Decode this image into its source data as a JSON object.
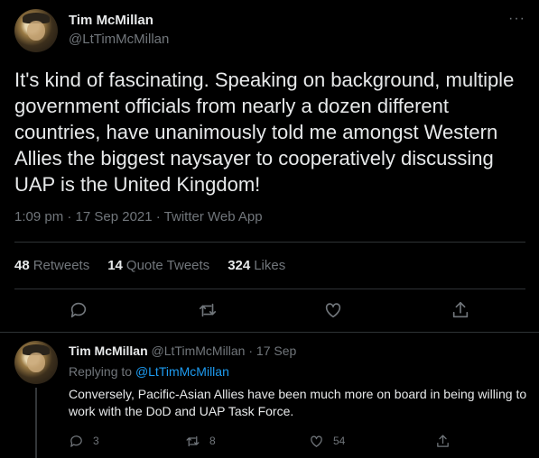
{
  "tweet": {
    "author_name": "Tim McMillan",
    "author_handle": "@LtTimMcMillan",
    "more_glyph": "···",
    "text": "It's kind of fascinating. Speaking on background, multiple government officials from nearly a dozen different countries, have unanimously told me amongst Western Allies the biggest naysayer to cooperatively discussing UAP is the United Kingdom!",
    "timestamp": "1:09 pm · 17 Sep 2021 · Twitter Web App",
    "stats": [
      {
        "count": "48",
        "label": "Retweets"
      },
      {
        "count": "14",
        "label": "Quote Tweets"
      },
      {
        "count": "324",
        "label": "Likes"
      }
    ],
    "actions": [
      {
        "icon": "reply-icon"
      },
      {
        "icon": "retweet-icon"
      },
      {
        "icon": "like-icon"
      },
      {
        "icon": "share-icon"
      }
    ]
  },
  "reply": {
    "author_name": "Tim McMillan",
    "author_meta": "@LtTimMcMillan · 17 Sep",
    "replying_prefix": "Replying to",
    "replying_handle": "@LtTimMcMillan",
    "text": "Conversely, Pacific-Asian Allies have been much more on board in being willing to work with the DoD and UAP Task Force.",
    "reply_count": "3",
    "retweet_count": "8",
    "like_count": "54"
  },
  "colors": {
    "background": "#000000",
    "text_primary": "#e7e9ea",
    "text_secondary": "#71767b",
    "link": "#1d9bf0",
    "divider": "#2f3336"
  }
}
